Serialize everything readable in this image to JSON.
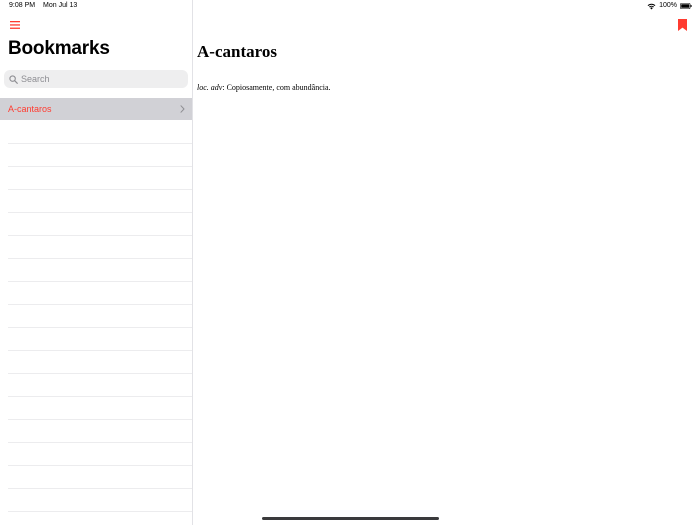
{
  "status_bar": {
    "time": "9:08 PM",
    "date": "Mon Jul 13",
    "battery": "100%"
  },
  "sidebar": {
    "title": "Bookmarks",
    "search_placeholder": "Search",
    "items": [
      {
        "label": "A-cantaros",
        "selected": true
      }
    ],
    "empty_row_count": 17
  },
  "detail": {
    "title": "A-cantaros",
    "definition": {
      "grammar": "loc. adv",
      "separator": ": ",
      "text": "Copiosamente, com abundância."
    }
  },
  "colors": {
    "accent": "#ff3b30",
    "selected_row": "#d1d1d6",
    "search_bg": "#eeeeef",
    "separator": "#ececee"
  },
  "icons": {
    "menu": "hamburger-menu-icon",
    "search": "magnifier-icon",
    "chevron": "chevron-right-icon",
    "bookmark": "bookmark-flag-icon",
    "wifi": "wifi-icon",
    "battery": "battery-icon"
  }
}
